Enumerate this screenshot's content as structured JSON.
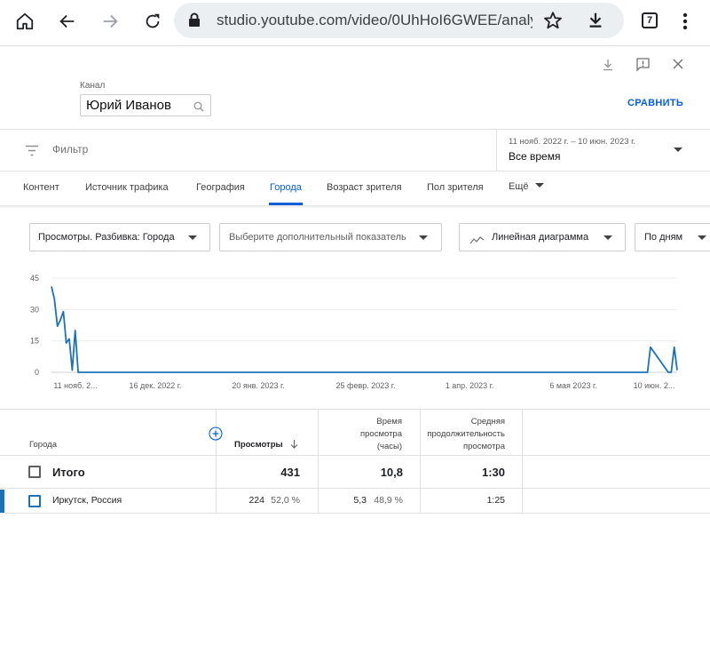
{
  "browser": {
    "url": "studio.youtube.com/video/0UhHoI6GWEE/analytic",
    "tab_count": "7"
  },
  "header": {
    "channel_label": "Канал",
    "channel_name": "Юрий Иванов",
    "compare_label": "СРАВНИТЬ"
  },
  "filter": {
    "placeholder": "Фильтр",
    "date_range": "11 нояб. 2022 г. – 10 июн. 2023 г.",
    "date_selected": "Все время"
  },
  "tabs": [
    {
      "label": "Контент"
    },
    {
      "label": "Источник трафика"
    },
    {
      "label": "География"
    },
    {
      "label": "Города"
    },
    {
      "label": "Возраст зрителя"
    },
    {
      "label": "Пол зрителя"
    },
    {
      "label": "Ещё"
    }
  ],
  "controls": {
    "metric": "Просмотры. Разбивка: Города",
    "extra_metric": "Выберите дополнительный показатель",
    "chart_type": "Линейная диаграмма",
    "period": "По дням"
  },
  "chart_data": {
    "type": "line",
    "y_ticks": [
      "45",
      "30",
      "15",
      "0"
    ],
    "x_ticks": [
      "11 нояб. 2...",
      "16 дек. 2022 г.",
      "20 янв. 2023 г.",
      "25 февр. 2023 г.",
      "1 апр. 2023 г.",
      "6 мая 2023 г.",
      "10 июн. 2..."
    ],
    "ylim": [
      0,
      45
    ],
    "series": [
      {
        "x": [
          0,
          1,
          2,
          3,
          4,
          5,
          6,
          7,
          8,
          9,
          10,
          11,
          12,
          200,
          201,
          202,
          208,
          209,
          210,
          211
        ],
        "values": [
          41,
          35,
          22,
          25,
          29,
          14,
          16,
          1,
          20,
          0,
          0,
          0,
          0,
          0,
          0,
          12,
          0,
          0,
          12,
          1
        ]
      }
    ],
    "x_max": 211,
    "color": "#1a73b8"
  },
  "table": {
    "col_city": "Города",
    "col_views": "Просмотры",
    "col_watch_line1": "Время",
    "col_watch_line2": "просмотра",
    "col_watch_line3": "(часы)",
    "col_avg_line1": "Средняя",
    "col_avg_line2": "продолжительность",
    "col_avg_line3": "просмотра",
    "total": {
      "label": "Итого",
      "views": "431",
      "watch": "10,8",
      "avg": "1:30"
    },
    "rows": [
      {
        "city": "Иркутск, Россия",
        "views": "224",
        "views_pct": "52,0 %",
        "watch": "5,3",
        "watch_pct": "48,9 %",
        "avg": "1:25"
      }
    ]
  }
}
